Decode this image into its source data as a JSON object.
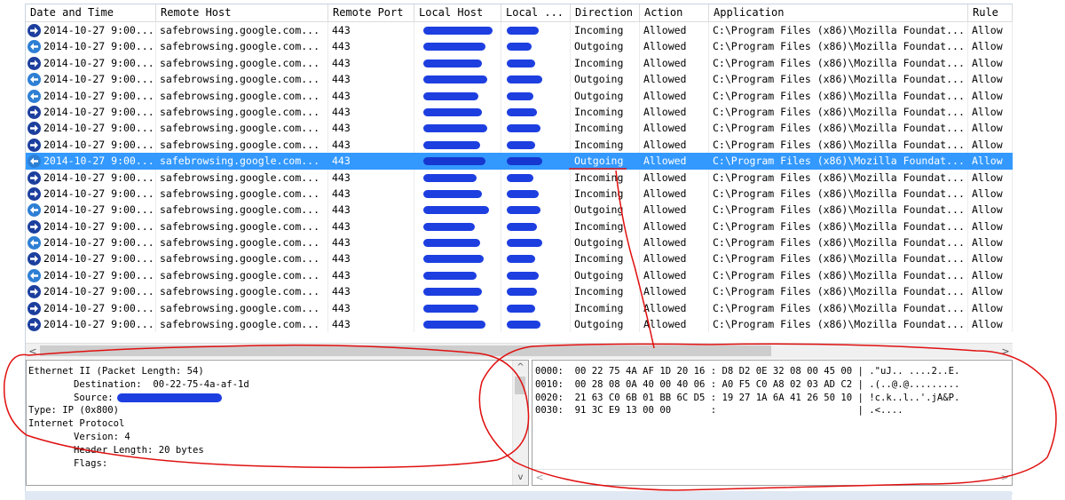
{
  "columns": [
    "Date and Time",
    "Remote Host",
    "Remote Port",
    "Local Host",
    "Local ...",
    "Direction",
    "Action",
    "Application",
    "Rule"
  ],
  "rows": [
    {
      "dir": "in",
      "date": "2014-10-27 9:00...",
      "host": "safebrowsing.google.com...",
      "port": "443",
      "direction": "Incoming",
      "action": "Allowed",
      "app": "C:\\Program Files (x86)\\Mozilla Foundat...",
      "rule": "Allow"
    },
    {
      "dir": "out",
      "date": "2014-10-27 9:00...",
      "host": "safebrowsing.google.com...",
      "port": "443",
      "direction": "Outgoing",
      "action": "Allowed",
      "app": "C:\\Program Files (x86)\\Mozilla Foundat...",
      "rule": "Allow"
    },
    {
      "dir": "in",
      "date": "2014-10-27 9:00...",
      "host": "safebrowsing.google.com...",
      "port": "443",
      "direction": "Incoming",
      "action": "Allowed",
      "app": "C:\\Program Files (x86)\\Mozilla Foundat...",
      "rule": "Allow"
    },
    {
      "dir": "out",
      "date": "2014-10-27 9:00...",
      "host": "safebrowsing.google.com...",
      "port": "443",
      "direction": "Outgoing",
      "action": "Allowed",
      "app": "C:\\Program Files (x86)\\Mozilla Foundat...",
      "rule": "Allow"
    },
    {
      "dir": "out",
      "date": "2014-10-27 9:00...",
      "host": "safebrowsing.google.com...",
      "port": "443",
      "direction": "Outgoing",
      "action": "Allowed",
      "app": "C:\\Program Files (x86)\\Mozilla Foundat...",
      "rule": "Allow"
    },
    {
      "dir": "in",
      "date": "2014-10-27 9:00...",
      "host": "safebrowsing.google.com...",
      "port": "443",
      "direction": "Incoming",
      "action": "Allowed",
      "app": "C:\\Program Files (x86)\\Mozilla Foundat...",
      "rule": "Allow"
    },
    {
      "dir": "in",
      "date": "2014-10-27 9:00...",
      "host": "safebrowsing.google.com...",
      "port": "443",
      "direction": "Incoming",
      "action": "Allowed",
      "app": "C:\\Program Files (x86)\\Mozilla Foundat...",
      "rule": "Allow"
    },
    {
      "dir": "in",
      "date": "2014-10-27 9:00...",
      "host": "safebrowsing.google.com...",
      "port": "443",
      "direction": "Incoming",
      "action": "Allowed",
      "app": "C:\\Program Files (x86)\\Mozilla Foundat...",
      "rule": "Allow"
    },
    {
      "dir": "out",
      "date": "2014-10-27 9:00...",
      "host": "safebrowsing.google.com...",
      "port": "443",
      "direction": "Outgoing",
      "action": "Allowed",
      "app": "C:\\Program Files (x86)\\Mozilla Foundat...",
      "rule": "Allow",
      "selected": true
    },
    {
      "dir": "in",
      "date": "2014-10-27 9:00...",
      "host": "safebrowsing.google.com...",
      "port": "443",
      "direction": "Incoming",
      "action": "Allowed",
      "app": "C:\\Program Files (x86)\\Mozilla Foundat...",
      "rule": "Allow"
    },
    {
      "dir": "in",
      "date": "2014-10-27 9:00...",
      "host": "safebrowsing.google.com...",
      "port": "443",
      "direction": "Incoming",
      "action": "Allowed",
      "app": "C:\\Program Files (x86)\\Mozilla Foundat...",
      "rule": "Allow"
    },
    {
      "dir": "out",
      "date": "2014-10-27 9:00...",
      "host": "safebrowsing.google.com...",
      "port": "443",
      "direction": "Outgoing",
      "action": "Allowed",
      "app": "C:\\Program Files (x86)\\Mozilla Foundat...",
      "rule": "Allow"
    },
    {
      "dir": "in",
      "date": "2014-10-27 9:00...",
      "host": "safebrowsing.google.com...",
      "port": "443",
      "direction": "Incoming",
      "action": "Allowed",
      "app": "C:\\Program Files (x86)\\Mozilla Foundat...",
      "rule": "Allow"
    },
    {
      "dir": "out",
      "date": "2014-10-27 9:00...",
      "host": "safebrowsing.google.com...",
      "port": "443",
      "direction": "Outgoing",
      "action": "Allowed",
      "app": "C:\\Program Files (x86)\\Mozilla Foundat...",
      "rule": "Allow"
    },
    {
      "dir": "in",
      "date": "2014-10-27 9:00...",
      "host": "safebrowsing.google.com...",
      "port": "443",
      "direction": "Incoming",
      "action": "Allowed",
      "app": "C:\\Program Files (x86)\\Mozilla Foundat...",
      "rule": "Allow"
    },
    {
      "dir": "out",
      "date": "2014-10-27 9:00...",
      "host": "safebrowsing.google.com...",
      "port": "443",
      "direction": "Outgoing",
      "action": "Allowed",
      "app": "C:\\Program Files (x86)\\Mozilla Foundat...",
      "rule": "Allow"
    },
    {
      "dir": "in",
      "date": "2014-10-27 9:00...",
      "host": "safebrowsing.google.com...",
      "port": "443",
      "direction": "Incoming",
      "action": "Allowed",
      "app": "C:\\Program Files (x86)\\Mozilla Foundat...",
      "rule": "Allow"
    },
    {
      "dir": "in",
      "date": "2014-10-27 9:00...",
      "host": "safebrowsing.google.com...",
      "port": "443",
      "direction": "Incoming",
      "action": "Allowed",
      "app": "C:\\Program Files (x86)\\Mozilla Foundat...",
      "rule": "Allow"
    },
    {
      "dir": "in",
      "date": "2014-10-27 9:00...",
      "host": "safebrowsing.google.com...",
      "port": "443",
      "direction": "Outgoing",
      "action": "Allowed",
      "app": "C:\\Program Files (x86)\\Mozilla Foundat...",
      "rule": "Allow"
    }
  ],
  "details": {
    "line1": "Ethernet II (Packet Length: 54)",
    "destination_label": "Destination:",
    "destination_value": "00-22-75-4a-af-1d",
    "source_label": "Source:",
    "line4": "Type: IP (0x800)",
    "line5": "Internet Protocol",
    "line6": "Version: 4",
    "line7": "Header Length: 20 bytes",
    "line8": "Flags:"
  },
  "hex": [
    "0000:  00 22 75 4A AF 1D 20 16 : D8 D2 0E 32 08 00 45 00 | .\"uJ.. ....2..E.",
    "0010:  00 28 08 0A 40 00 40 06 : A0 F5 C0 A8 02 03 AD C2 | .(..@.@.........",
    "0020:  21 63 C0 6B 01 BB 6C D5 : 19 27 1A 6A 41 26 50 10 | !c.k..l..'.jA&P.",
    "0030:  91 3C E9 13 00 00       :                         | .<...."
  ],
  "scroll": {
    "left": "<",
    "right": ">",
    "up": "^",
    "down": "v"
  },
  "colors": {
    "selection": "#3399ff",
    "annotation": "#e01010",
    "redaction": "#1d3fe0",
    "incoming_icon": "#1c3f9e",
    "outgoing_icon": "#2d7fd4"
  }
}
